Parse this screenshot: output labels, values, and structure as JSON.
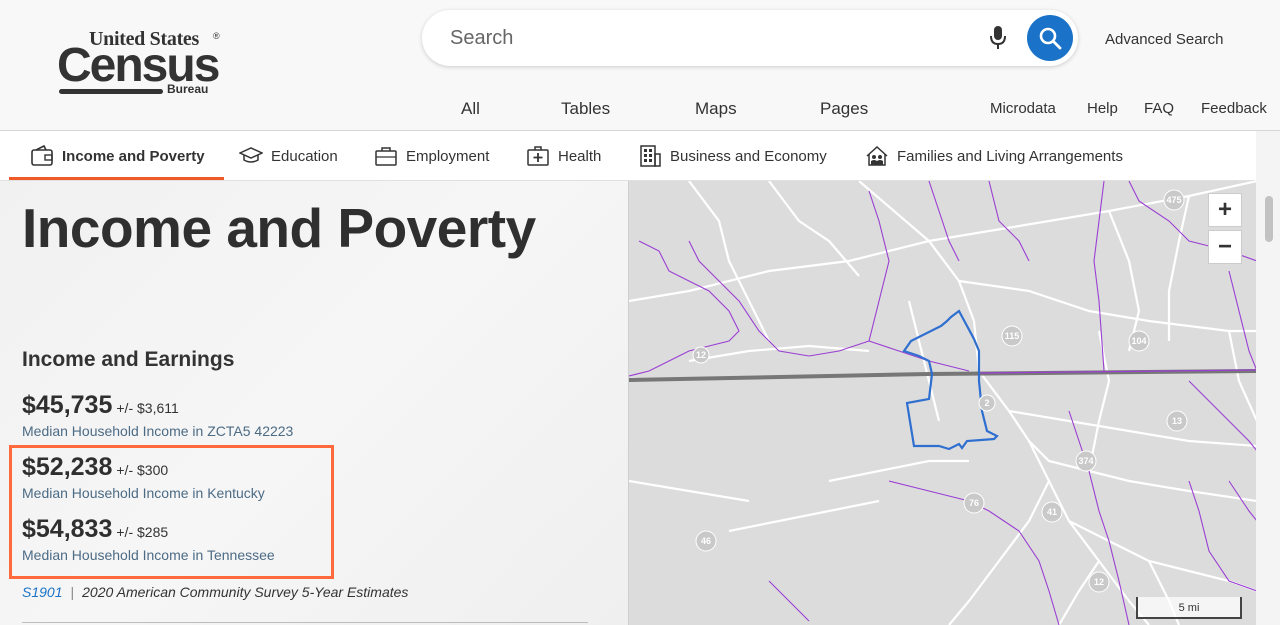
{
  "header": {
    "logo_line1": "United States",
    "logo_line2": "Census",
    "logo_line3": "Bureau",
    "search_placeholder": "Search",
    "advanced_search": "Advanced Search",
    "tabs": [
      "All",
      "Tables",
      "Maps",
      "Pages"
    ],
    "links": [
      "Microdata",
      "Help",
      "FAQ",
      "Feedback"
    ]
  },
  "topics": [
    {
      "label": "Income and Poverty",
      "icon": "wallet-icon",
      "active": true
    },
    {
      "label": "Education",
      "icon": "graduation-cap-icon",
      "active": false
    },
    {
      "label": "Employment",
      "icon": "briefcase-icon",
      "active": false
    },
    {
      "label": "Health",
      "icon": "medical-kit-icon",
      "active": false
    },
    {
      "label": "Business and Economy",
      "icon": "building-icon",
      "active": false
    },
    {
      "label": "Families and Living Arrangements",
      "icon": "house-family-icon",
      "active": false
    }
  ],
  "main": {
    "title": "Income and Poverty",
    "section_title": "Income and Earnings",
    "stats": [
      {
        "value": "$45,735",
        "moe": "+/- $3,611",
        "label": "Median Household Income in ZCTA5 42223"
      },
      {
        "value": "$52,238",
        "moe": "+/- $300",
        "label": "Median Household Income in Kentucky"
      },
      {
        "value": "$54,833",
        "moe": "+/- $285",
        "label": "Median Household Income in Tennessee"
      }
    ],
    "source_code": "S1901",
    "source_text": "2020 American Community Survey 5-Year Estimates"
  },
  "map": {
    "zoom_in": "+",
    "zoom_out": "−",
    "scale_label": "5 mi",
    "route_labels": [
      "475",
      "115",
      "104",
      "12",
      "2",
      "13",
      "374",
      "76",
      "41",
      "46",
      "12"
    ]
  },
  "colors": {
    "accent": "#f05a28",
    "highlight_box": "#ff6a3d",
    "link_blue": "#1a73c8",
    "label_blue": "#4c6b85",
    "map_bg": "#dcdcdc",
    "boundary_purple": "#9b3fd4",
    "zcta_outline": "#2f6fd0",
    "state_line": "#777777"
  }
}
